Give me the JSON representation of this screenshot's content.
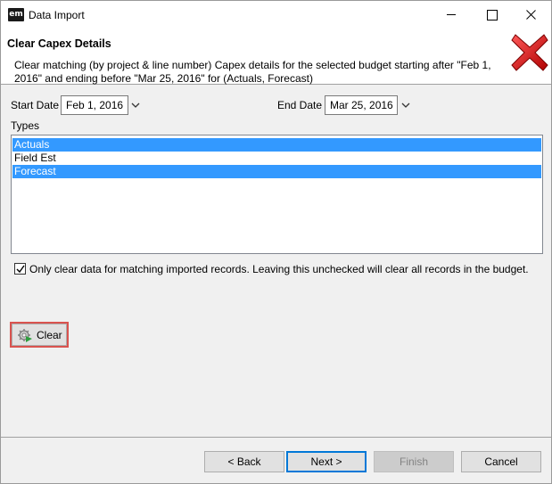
{
  "window": {
    "app_icon": "em",
    "title": "Data Import"
  },
  "header": {
    "title": "Clear Capex Details",
    "description": "Clear matching (by project & line number) Capex details for the selected budget starting after \"Feb 1, 2016\" and ending before \"Mar 25, 2016\" for (Actuals, Forecast)",
    "icon": "red-x-icon"
  },
  "form": {
    "start_date_label": "Start Date",
    "start_date_value": "Feb 1, 2016",
    "end_date_label": "End Date",
    "end_date_value": "Mar 25, 2016",
    "types_label": "Types",
    "types": [
      {
        "label": "Actuals",
        "selected": true
      },
      {
        "label": "Field Est",
        "selected": false
      },
      {
        "label": "Forecast",
        "selected": true
      }
    ],
    "only_matching_checked": true,
    "only_matching_label": "Only clear data for matching imported records.  Leaving this unchecked will clear all records in the budget."
  },
  "actions": {
    "clear_label": "Clear"
  },
  "footer": {
    "back_label": "< Back",
    "next_label": "Next >",
    "finish_label": "Finish",
    "cancel_label": "Cancel"
  },
  "colors": {
    "selection": "#3399ff",
    "highlight_border": "#d9534f",
    "primary_border": "#0078d7"
  }
}
